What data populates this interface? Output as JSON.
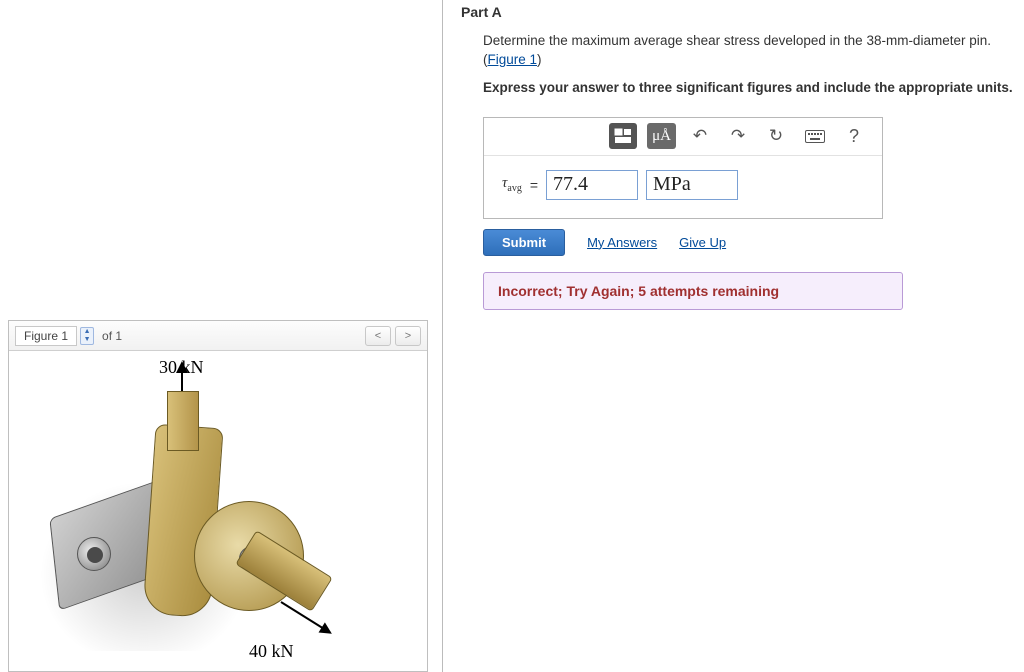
{
  "figure_panel": {
    "title": "Figure 1",
    "of_label": "of 1",
    "labels": {
      "top_force": "30 kN",
      "bottom_force": "40 kN"
    }
  },
  "part": {
    "heading": "Part A",
    "prompt_line1": "Determine the maximum average shear stress developed in the 38-mm-diameter pin.",
    "figure_link": "Figure 1",
    "instruction": "Express your answer to three significant figures and include the appropriate units."
  },
  "answer": {
    "symbol_html": "τ",
    "symbol_sub": "avg",
    "equals": "=",
    "value": "77.4",
    "unit": "MPa",
    "toolbar": {
      "units_btn": "μÅ",
      "help": "?"
    }
  },
  "actions": {
    "submit": "Submit",
    "my_answers": "My Answers",
    "give_up": "Give Up"
  },
  "feedback": "Incorrect; Try Again; 5 attempts remaining"
}
